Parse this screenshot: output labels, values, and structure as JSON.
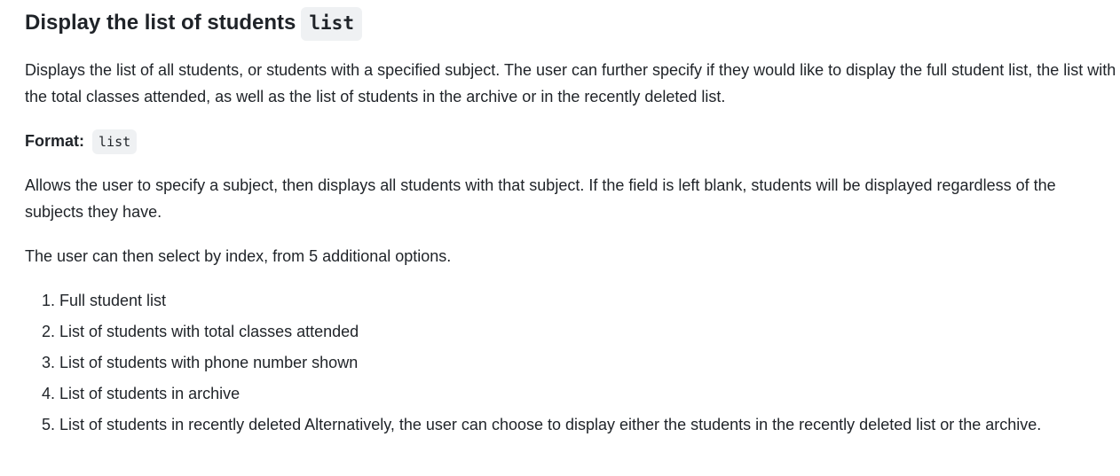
{
  "section": {
    "title": "Display the list of students",
    "command": "list",
    "description": "Displays the list of all students, or students with a specified subject. The user can further specify if they would like to display the full student list, the list with the total classes attended, as well as the list of students in the archive or in the recently deleted list.",
    "format_label": "Format:",
    "format_code": "list",
    "subject_text": "Allows the user to specify a subject, then displays all students with that subject. If the field is left blank, students will be displayed regardless of the subjects they have.",
    "options_intro": "The user can then select by index, from 5 additional options.",
    "options": [
      "Full student list",
      "List of students with total classes attended",
      "List of students with phone number shown",
      "List of students in archive",
      "List of students in recently deleted Alternatively, the user can choose to display either the students in the recently deleted list or the archive."
    ]
  }
}
